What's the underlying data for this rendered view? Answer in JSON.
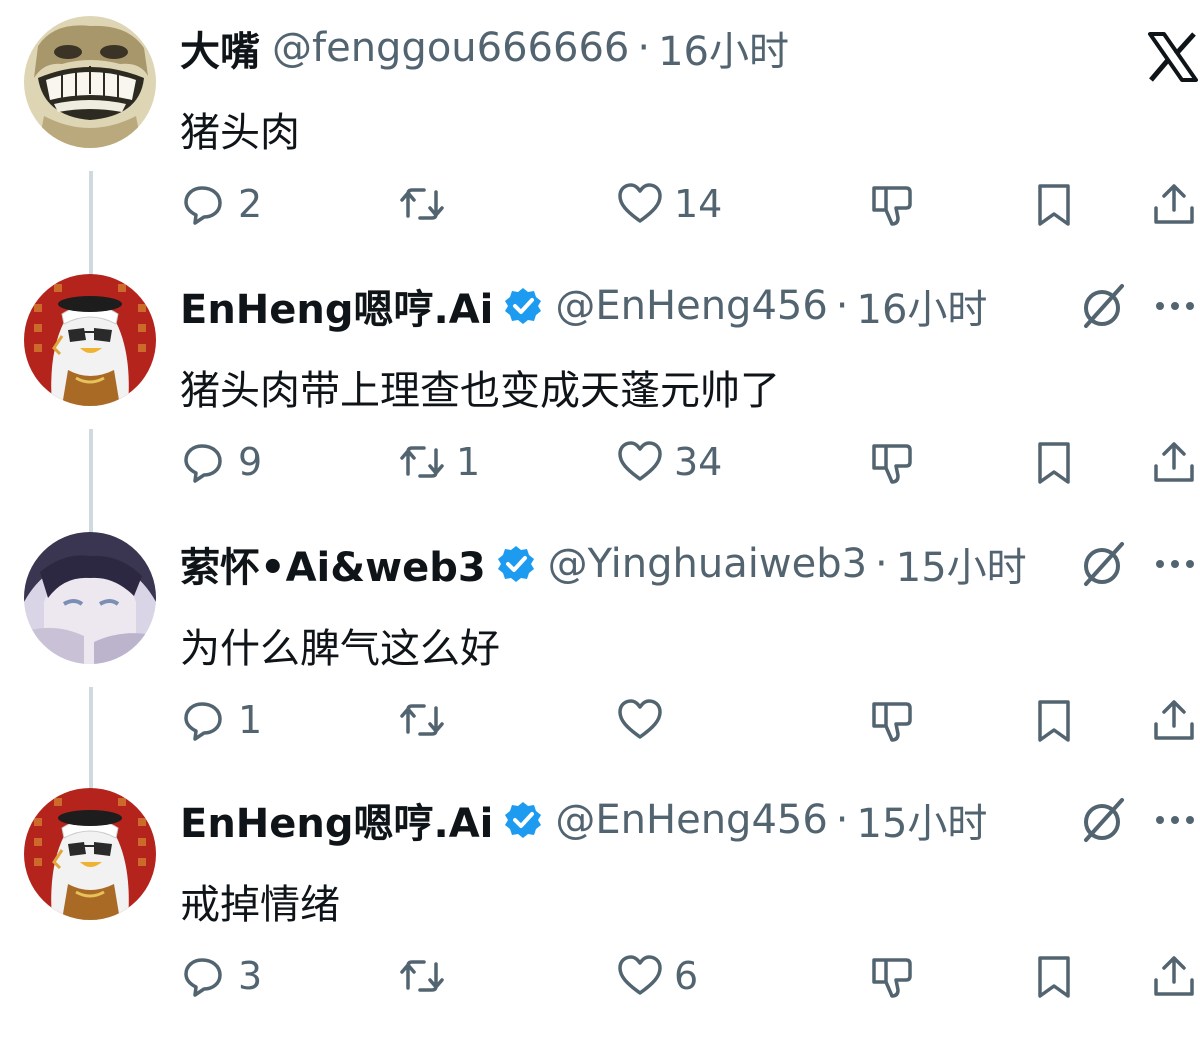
{
  "tweets": [
    {
      "display_name": "大嘴",
      "handle": "@fenggou666666",
      "time": "16小时",
      "text": "猪头肉",
      "verified": false,
      "avatar": "meme-face-avatar",
      "counts": {
        "reply": "2",
        "retweet": "",
        "like": "14"
      }
    },
    {
      "display_name": "EnHeng嗯哼.Ai",
      "handle": "@EnHeng456",
      "time": "16小时",
      "text": "猪头肉带上理查也变成天蓬元帅了",
      "verified": true,
      "avatar": "penguin-keffiyeh-avatar",
      "counts": {
        "reply": "9",
        "retweet": "1",
        "like": "34"
      }
    },
    {
      "display_name": "萦怀•Ai&web3",
      "handle": "@Yinghuaiweb3",
      "time": "15小时",
      "text": "为什么脾气这么好",
      "verified": true,
      "avatar": "anime-girl-avatar",
      "counts": {
        "reply": "1",
        "retweet": "",
        "like": ""
      }
    },
    {
      "display_name": "EnHeng嗯哼.Ai",
      "handle": "@EnHeng456",
      "time": "15小时",
      "text": "戒掉情绪",
      "verified": true,
      "avatar": "penguin-keffiyeh-avatar",
      "counts": {
        "reply": "3",
        "retweet": "",
        "like": "6"
      }
    }
  ],
  "separator": "·",
  "icons": {
    "reply": "speech-bubble-icon",
    "retweet": "retweet-arrows-icon",
    "like": "heart-icon",
    "dislike": "thumb-down-icon",
    "bookmark": "bookmark-icon",
    "share": "share-upload-icon",
    "grok": "grok-slash-icon",
    "more": "more-dots-icon",
    "app": "x-logo-icon"
  },
  "colors": {
    "text": "#0f1419",
    "secondary": "#536471",
    "verified": "#1d9bf0",
    "thread_line": "#cfd9de",
    "avatar_red_bg": "#b4231c"
  }
}
